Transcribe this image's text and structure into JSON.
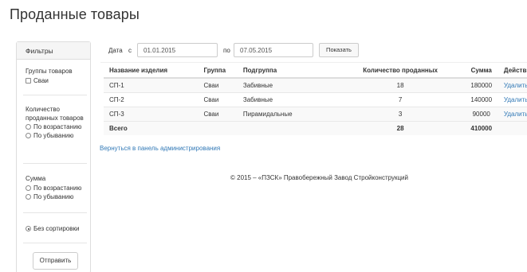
{
  "page": {
    "title": "Проданные товары"
  },
  "filters": {
    "header": "Фильтры",
    "groups_label": "Группы товаров",
    "groups": [
      {
        "label": "Сваи",
        "checked": false
      }
    ],
    "quantity_label": "Количество проданных товаров",
    "quantity_options": [
      {
        "label": "По возрастанию",
        "selected": false
      },
      {
        "label": "По убыванию",
        "selected": false
      }
    ],
    "sum_label": "Сумма",
    "sum_options": [
      {
        "label": "По возрастанию",
        "selected": false
      },
      {
        "label": "По убыванию",
        "selected": false
      }
    ],
    "no_sort": {
      "label": "Без сортировки",
      "selected": true
    },
    "submit_label": "Отправить"
  },
  "date_filter": {
    "date_label": "Дата",
    "from_label": "с",
    "from_value": "01.01.2015",
    "to_label": "по",
    "to_value": "07.05.2015",
    "show_label": "Показать"
  },
  "table": {
    "headers": [
      "Название изделия",
      "Группа",
      "Подгруппа",
      "Количество проданных",
      "Сумма",
      "Действия"
    ],
    "rows": [
      {
        "name": "СП-1",
        "group": "Сваи",
        "subgroup": "Забивные",
        "qty": "18",
        "sum": "180000",
        "action": "Удалить"
      },
      {
        "name": "СП-2",
        "group": "Сваи",
        "subgroup": "Забивные",
        "qty": "7",
        "sum": "140000",
        "action": "Удалить"
      },
      {
        "name": "СП-3",
        "group": "Сваи",
        "subgroup": "Пирамидальные",
        "qty": "3",
        "sum": "90000",
        "action": "Удалить"
      }
    ],
    "total": {
      "label": "Всего",
      "qty": "28",
      "sum": "410000"
    }
  },
  "back_link": "Вернуться в панель администрирования",
  "footer": "© 2015 – «ПЗСК» Правобережный Завод Стройконструкций"
}
